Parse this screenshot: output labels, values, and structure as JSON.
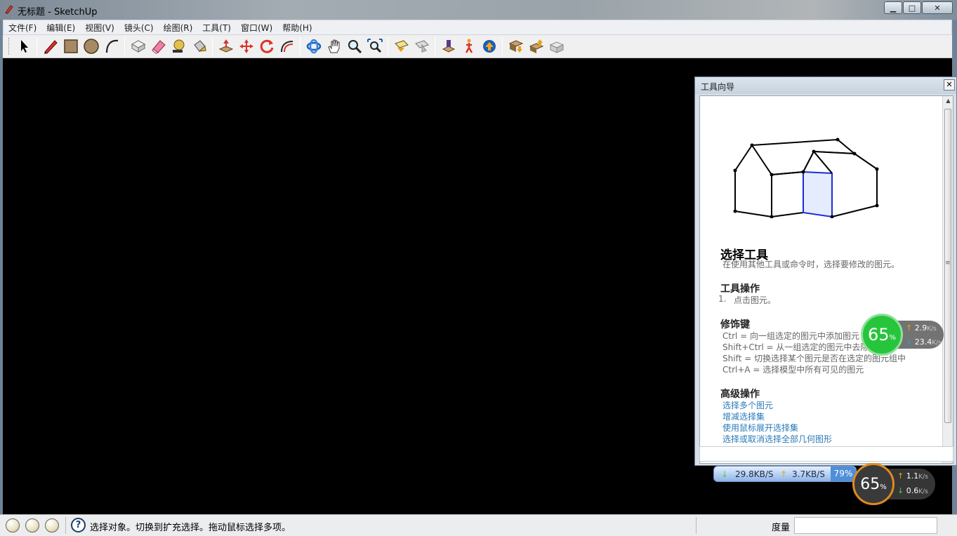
{
  "window": {
    "title": "无标题 - SketchUp",
    "minimize": "▁",
    "maximize": "□",
    "close": "✕"
  },
  "menu": [
    "文件(F)",
    "编辑(E)",
    "视图(V)",
    "镜头(C)",
    "绘图(R)",
    "工具(T)",
    "窗口(W)",
    "帮助(H)"
  ],
  "toolbar": {
    "groups": [
      [
        "select-icon"
      ],
      [
        "pencil-icon",
        "rectangle-icon",
        "circle-icon",
        "arc-icon"
      ],
      [
        "make-component-icon",
        "eraser-icon",
        "tape-measure-icon",
        "paint-bucket-icon"
      ],
      [
        "push-pull-icon",
        "move-icon",
        "rotate-icon",
        "offset-icon"
      ],
      [
        "orbit-icon",
        "pan-icon",
        "zoom-icon",
        "zoom-extents-icon"
      ],
      [
        "previous-view-icon",
        "next-view-icon"
      ],
      [
        "position-camera-icon",
        "walk-icon",
        "look-around-icon"
      ],
      [
        "get-models-icon",
        "share-model-icon",
        "share-component-icon"
      ]
    ]
  },
  "instructor": {
    "title": "工具向导",
    "close": "✕",
    "heading": "选择工具",
    "description": "在使用其他工具或命令时，选择要修改的图元。",
    "ops_heading": "工具操作",
    "ops_number": "1.",
    "ops_item": "点击图元。",
    "modifier_heading": "修饰键",
    "modifiers": [
      "Ctrl = 向一组选定的图元中添加图元",
      "Shift+Ctrl = 从一组选定的图元中去除图元",
      "Shift = 切换选择某个图元是否在选定的图元组中",
      "Ctrl+A = 选择模型中所有可见的图元"
    ],
    "advanced_heading": "高级操作",
    "advanced_links": [
      "选择多个图元",
      "增减选择集",
      "使用鼠标展开选择集",
      "选择或取消选择全部几何图形"
    ],
    "scroll_grip": "≡"
  },
  "net_widget_1": {
    "percent": "65",
    "percent_sign": "%",
    "up_arrow": "↑",
    "down_arrow": "↓",
    "up": "2.9",
    "down": "23.4",
    "unit": "K/s"
  },
  "net_bar": {
    "down": "29.8KB/S",
    "up": "3.7KB/S",
    "pct": "79%",
    "down_arrow": "↓",
    "up_arrow": "↑"
  },
  "net_widget_2": {
    "percent": "65",
    "percent_sign": "%",
    "up_arrow": "↑",
    "down_arrow": "↓",
    "up": "1.1",
    "down": "0.6",
    "unit": "K/s"
  },
  "status": {
    "help_glyph": "?",
    "text": "选择对象。切换到扩充选择。拖动鼠标选择多项。",
    "measure_label": "度量",
    "measure_value": ""
  }
}
